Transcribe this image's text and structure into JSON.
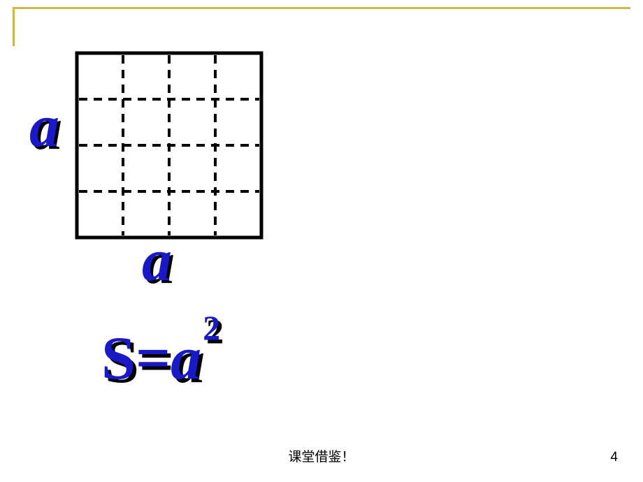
{
  "labels": {
    "side_left": "a",
    "side_bottom": "a",
    "formula_s": "S",
    "formula_eq": "=",
    "formula_a": "a",
    "formula_exp": "2"
  },
  "grid": {
    "cells": 4
  },
  "footer": {
    "text": "课堂借鉴！",
    "page": "4"
  }
}
